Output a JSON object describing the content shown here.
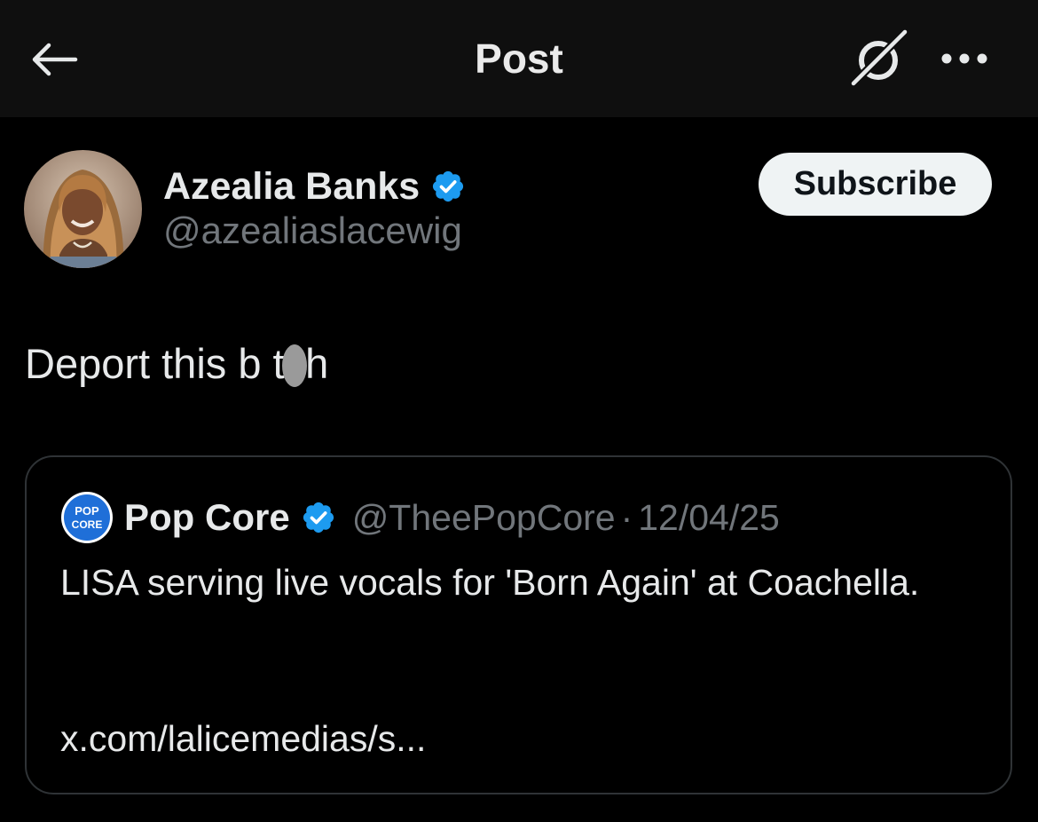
{
  "header": {
    "title": "Post",
    "back_icon": "arrow-left-icon",
    "grok_icon": "grok-icon",
    "more_icon": "more-horizontal-icon"
  },
  "author": {
    "display_name": "Azealia Banks",
    "handle": "@azealiaslacewig",
    "verified": true,
    "subscribe_label": "Subscribe"
  },
  "post": {
    "text": "Deport this b tch"
  },
  "quote": {
    "avatar_text_line1": "POP",
    "avatar_text_line2": "CORE",
    "display_name": "Pop Core",
    "verified": true,
    "handle": "@TheePopCore",
    "separator": "·",
    "date": "12/04/25",
    "text": "LISA serving live vocals for 'Born Again' at Coachella.",
    "link": "x.com/lalicemedias/s..."
  },
  "colors": {
    "background": "#000000",
    "header_bg": "#0f0f0f",
    "text_primary": "#e7e9ea",
    "text_secondary": "#71767b",
    "verified_blue": "#1d9bf0",
    "button_bg": "#eff3f4",
    "border": "#2f3336"
  }
}
